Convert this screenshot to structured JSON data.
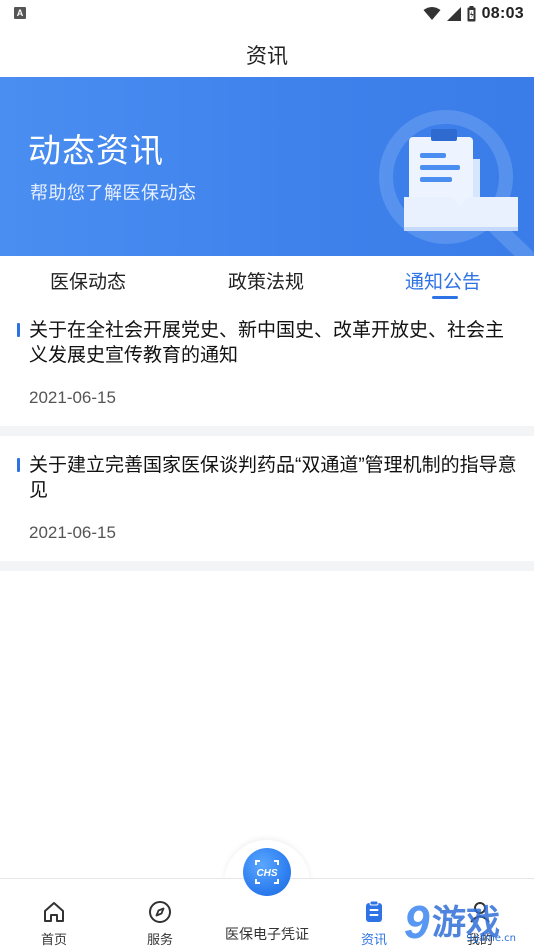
{
  "status_bar": {
    "left_badge": "A",
    "time": "08:03"
  },
  "header": {
    "title": "资讯"
  },
  "banner": {
    "title": "动态资讯",
    "subtitle": "帮助您了解医保动态"
  },
  "tabs": [
    {
      "label": "医保动态",
      "active": false
    },
    {
      "label": "政策法规",
      "active": false
    },
    {
      "label": "通知公告",
      "active": true
    }
  ],
  "news": [
    {
      "title": "关于在全社会开展党史、新中国史、改革开放史、社会主义发展史宣传教育的通知",
      "date": "2021-06-15"
    },
    {
      "title": "关于建立完善国家医保谈判药品“双通道”管理机制的指导意见",
      "date": "2021-06-15"
    }
  ],
  "bottom_nav": {
    "items": [
      {
        "label": "首页",
        "icon": "home-icon"
      },
      {
        "label": "服务",
        "icon": "compass-icon"
      },
      {
        "label": "医保电子凭证",
        "icon": "chs-badge-icon"
      },
      {
        "label": "资讯",
        "icon": "news-icon",
        "active": true
      },
      {
        "label": "我的",
        "icon": "user-icon"
      }
    ],
    "center_badge": "CHS"
  },
  "watermark": {
    "big": "9",
    "text": "游戏",
    "url": "9game.cn"
  },
  "colors": {
    "accent": "#2e73e6",
    "banner": "#4387ee"
  }
}
